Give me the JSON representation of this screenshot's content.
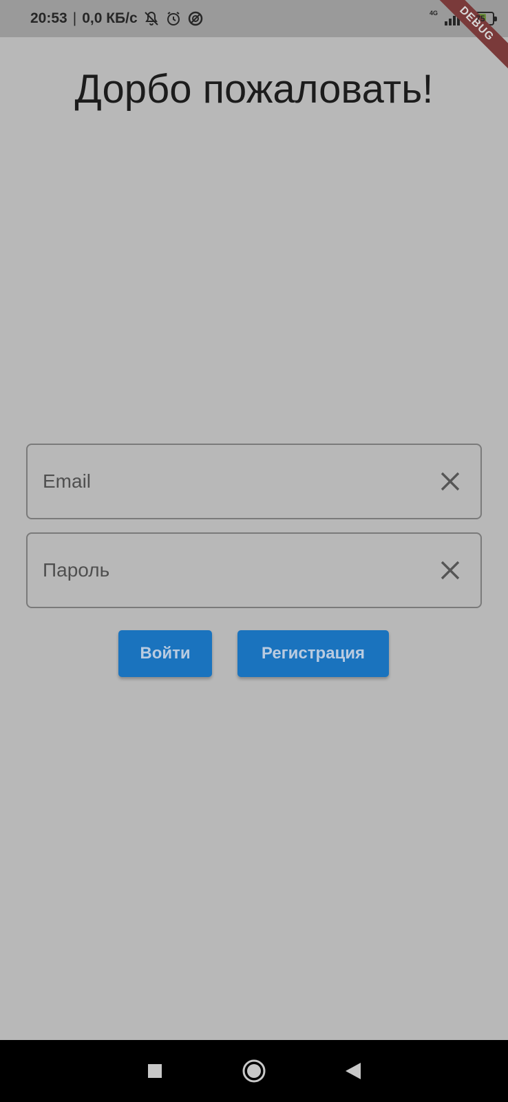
{
  "status_bar": {
    "time": "20:53",
    "separator": "|",
    "network_speed": "0,0 КБ/с",
    "network_type": "4G",
    "battery_level": "75",
    "battery_fraction": 0.75,
    "icons": [
      "notifications-off-icon",
      "alarm-icon",
      "data-saver-icon",
      "signal-icon",
      "battery-charging-icon"
    ]
  },
  "debug_banner": "DEBUG",
  "title": "Дорбо пожаловать!",
  "form": {
    "email_placeholder": "Email",
    "email_value": "",
    "password_placeholder": "Пароль",
    "password_value": ""
  },
  "buttons": {
    "login_label": "Войти",
    "register_label": "Регистрация"
  },
  "nav": {
    "icons": [
      "recents-square-icon",
      "home-circle-icon",
      "back-triangle-icon"
    ]
  },
  "colors": {
    "background": "#b8b8b8",
    "button": "#1a73be",
    "button_text": "#b9cbe0",
    "debug_ribbon": "#7a3a3a"
  }
}
